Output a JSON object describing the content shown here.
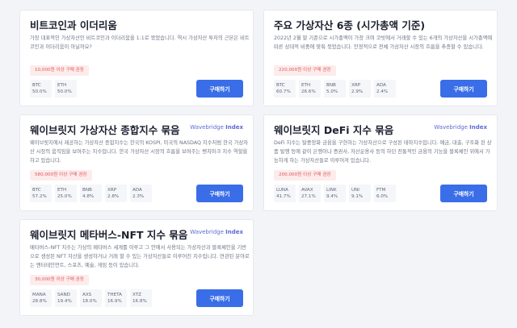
{
  "cards": [
    {
      "title": "비트코인과 이더리움",
      "brand": "",
      "brand_bold": "",
      "description": "가장 대표적인 가상자산인 비트코인과 이더리움을 1:1로 묶었습니다. 역시 가상자산 투자의 근본은 비트코인과 이더리움이 아닐까요?",
      "badge": "10,000원 이상 구매 권장",
      "assets": [
        {
          "symbol": "BTC",
          "weight": "50.0%"
        },
        {
          "symbol": "ETH",
          "weight": "50.0%"
        }
      ],
      "button": "구매하기"
    },
    {
      "title": "주요 가상자산 6종 (시가총액 기준)",
      "brand": "",
      "brand_bold": "",
      "description": "2022년 2월 말 기준으로 시가총액이 가장 크며 코빗에서 거래할 수 있는 6개의 가상자산을 시가총액에 따른 상대적 비중에 맞춰 묶었습니다. 안정적으로 전체 가상자산 시장의 흐름을 추종할 수 있습니다.",
      "badge": "220,000원 이상 구매 권장",
      "assets": [
        {
          "symbol": "BTC",
          "weight": "60.7%"
        },
        {
          "symbol": "ETH",
          "weight": "26.6%"
        },
        {
          "symbol": "BNB",
          "weight": "5.0%"
        },
        {
          "symbol": "XRP",
          "weight": "2.9%"
        },
        {
          "symbol": "ADA",
          "weight": "2.4%"
        }
      ],
      "button": "구매하기"
    },
    {
      "title": "웨이브릿지 가상자산 종합지수 묶음",
      "brand": "Wavebridge ",
      "brand_bold": "Index",
      "description": "웨이브릿지에서 제공하는 가상자산 종합지수는 한국의 KOSPI, 미국의 NASDAQ 지수처럼 한국 가상자산 시장의 움직임을 보여주는 지수입니다. 한국 가상자산 시장의 흐름을 보여주는 벤치마크 지수 역할을 하고 있습니다.",
      "badge": "580,000원 이상 구매 권장",
      "assets": [
        {
          "symbol": "BTC",
          "weight": "57.2%"
        },
        {
          "symbol": "ETH",
          "weight": "25.0%"
        },
        {
          "symbol": "BNB",
          "weight": "4.8%"
        },
        {
          "symbol": "XRP",
          "weight": "2.8%"
        },
        {
          "symbol": "ADA",
          "weight": "2.3%"
        }
      ],
      "button": "구매하기"
    },
    {
      "title": "웨이브릿지 DeFi 지수 묶음",
      "brand": "Wavebridge ",
      "brand_bold": "Index",
      "description": "DeFi 지수는 탈중앙화 금융을 구현하는 가상자산으로 구성된 테마지수입니다. 예금, 대출, 구조화 된 상품 발행 등에 같이 은행이나 증권사, 자산운용사 등의 하던 전통적인 금융의 기능을 블록체인 위에서 가능하게 하는 가상자산들로 이루어져 있습니다.",
      "badge": "200,000원 이상 구매 권장",
      "assets": [
        {
          "symbol": "LUNA",
          "weight": "41.7%"
        },
        {
          "symbol": "AVAX",
          "weight": "27.1%"
        },
        {
          "symbol": "LINK",
          "weight": "9.4%"
        },
        {
          "symbol": "UNI",
          "weight": "9.1%"
        },
        {
          "symbol": "FTM",
          "weight": "6.0%"
        }
      ],
      "button": "구매하기"
    },
    {
      "title": "웨이브릿지 메타버스-NFT 지수 묶음",
      "brand": "Wavebridge ",
      "brand_bold": "Index",
      "description": "메타버스-NFT 지수는 가상의 메타버스 세계를 이루고 그 안에서 사용되는 가상자산과 블록체인을 기반으로 생성된 NFT 자산을 생성하거나 거래 할 수 있는 가상자산들로 이루어진 지수입니다. 연관된 분야로는 엔터테인먼트, 스포츠, 예술, 게임 등이 있습니다.",
      "badge": "30,000원 이상 구매 권장",
      "assets": [
        {
          "symbol": "MANA",
          "weight": "28.8%"
        },
        {
          "symbol": "SAND",
          "weight": "19.4%"
        },
        {
          "symbol": "AXS",
          "weight": "18.0%"
        },
        {
          "symbol": "THETA",
          "weight": "16.9%"
        },
        {
          "symbol": "XTZ",
          "weight": "16.8%"
        }
      ],
      "button": "구매하기"
    }
  ],
  "colors": {
    "background": "#f3f4f7",
    "card": "#ffffff",
    "button": "#3a6ee8",
    "badge_bg": "#fdecec",
    "badge_text": "#e15656",
    "brand": "#5b6bd6"
  }
}
